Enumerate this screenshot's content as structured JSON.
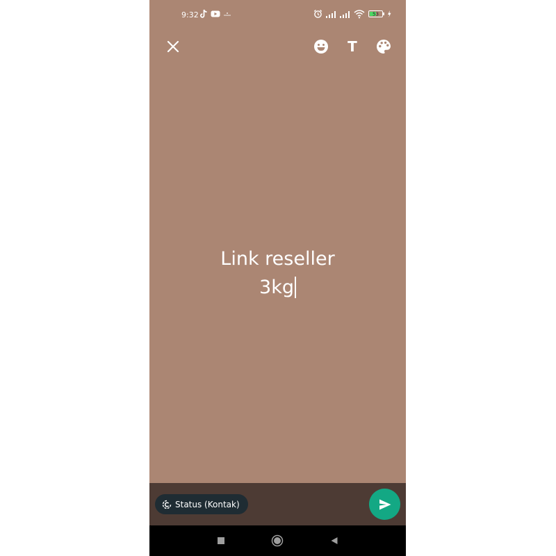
{
  "status_bar": {
    "time": "9:32",
    "battery_level": "53",
    "left_icons": [
      "tiktok-icon",
      "youtube-icon",
      "dots-icon"
    ],
    "right_icons": [
      "alarm-icon",
      "signal-icon",
      "signal-icon",
      "wifi-icon",
      "battery-icon",
      "charging-icon"
    ]
  },
  "toolbar": {
    "close_icon": "close-icon",
    "emoji_icon": "emoji-icon",
    "text_label": "T",
    "palette_icon": "palette-icon"
  },
  "content": {
    "lines": [
      "Link reseller",
      "3kg"
    ],
    "background_color": "#ab8673",
    "text_color": "#ffffff"
  },
  "bottom_bar": {
    "audience_label": "Status (Kontak)",
    "audience_icon": "status-icon",
    "send_icon": "send-icon",
    "accent_color": "#13a884"
  },
  "nav_bar": {
    "buttons": [
      "recents-icon",
      "home-icon",
      "back-icon"
    ]
  }
}
